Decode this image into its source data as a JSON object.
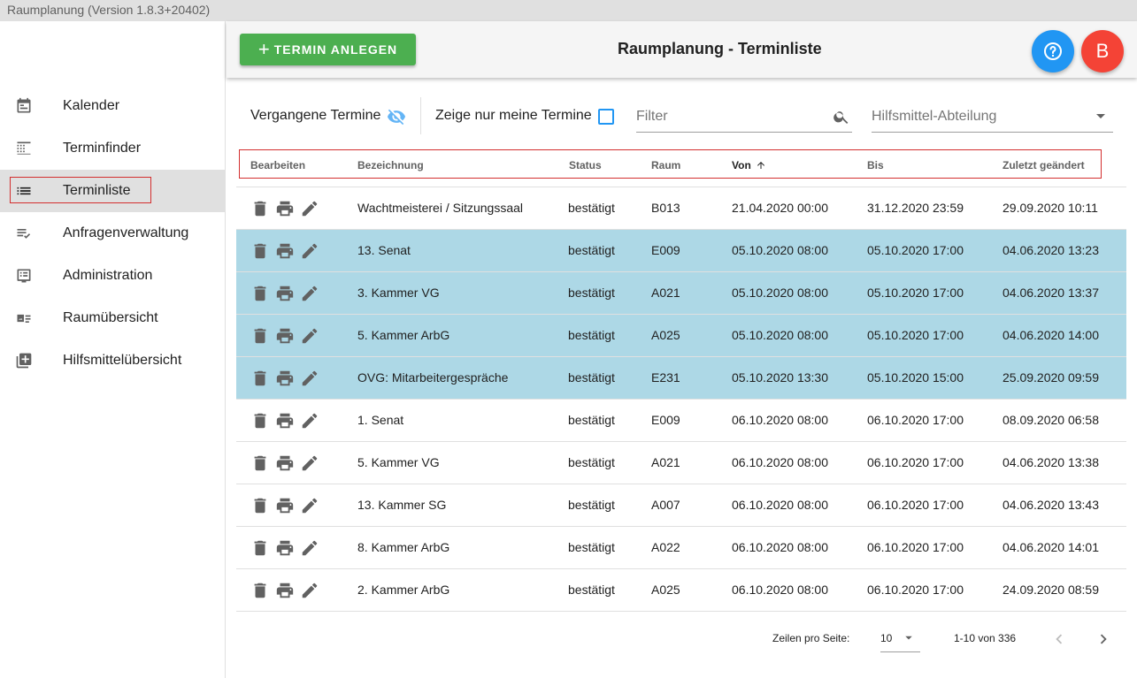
{
  "window": {
    "title": "Raumplanung (Version 1.8.3+20402)"
  },
  "sidebar": {
    "items": [
      {
        "label": "Kalender",
        "icon": "calendar-icon"
      },
      {
        "label": "Terminfinder",
        "icon": "grid-icon"
      },
      {
        "label": "Terminliste",
        "icon": "list-icon",
        "active": true
      },
      {
        "label": "Anfragenverwaltung",
        "icon": "playlist-check-icon"
      },
      {
        "label": "Administration",
        "icon": "admin-list-icon"
      },
      {
        "label": "Raumübersicht",
        "icon": "room-card-icon"
      },
      {
        "label": "Hilfsmittelübersicht",
        "icon": "library-add-icon"
      }
    ]
  },
  "header": {
    "add_button": "TERMIN ANLEGEN",
    "title": "Raumplanung - Terminliste",
    "user_initial": "B"
  },
  "filters": {
    "past_label": "Vergangene Termine",
    "mine_label": "Zeige nur meine Termine",
    "filter_placeholder": "Filter",
    "department_placeholder": "Hilfsmittel-Abteilung"
  },
  "table": {
    "columns": [
      "Bearbeiten",
      "Bezeichnung",
      "Status",
      "Raum",
      "Von",
      "Bis",
      "Zuletzt geändert"
    ],
    "sorted_column": "Von",
    "rows": [
      {
        "bezeichnung": "Wachtmeisterei / Sitzungssaal",
        "status": "bestätigt",
        "raum": "B013",
        "von": "21.04.2020 00:00",
        "bis": "31.12.2020 23:59",
        "geaendert": "29.09.2020 10:11",
        "highlight": false
      },
      {
        "bezeichnung": "13. Senat",
        "status": "bestätigt",
        "raum": "E009",
        "von": "05.10.2020 08:00",
        "bis": "05.10.2020 17:00",
        "geaendert": "04.06.2020 13:23",
        "highlight": true
      },
      {
        "bezeichnung": "3. Kammer VG",
        "status": "bestätigt",
        "raum": "A021",
        "von": "05.10.2020 08:00",
        "bis": "05.10.2020 17:00",
        "geaendert": "04.06.2020 13:37",
        "highlight": true
      },
      {
        "bezeichnung": "5. Kammer ArbG",
        "status": "bestätigt",
        "raum": "A025",
        "von": "05.10.2020 08:00",
        "bis": "05.10.2020 17:00",
        "geaendert": "04.06.2020 14:00",
        "highlight": true
      },
      {
        "bezeichnung": "OVG: Mitarbeitergespräche",
        "status": "bestätigt",
        "raum": "E231",
        "von": "05.10.2020 13:30",
        "bis": "05.10.2020 15:00",
        "geaendert": "25.09.2020 09:59",
        "highlight": true
      },
      {
        "bezeichnung": "1. Senat",
        "status": "bestätigt",
        "raum": "E009",
        "von": "06.10.2020 08:00",
        "bis": "06.10.2020 17:00",
        "geaendert": "08.09.2020 06:58",
        "highlight": false
      },
      {
        "bezeichnung": "5. Kammer VG",
        "status": "bestätigt",
        "raum": "A021",
        "von": "06.10.2020 08:00",
        "bis": "06.10.2020 17:00",
        "geaendert": "04.06.2020 13:38",
        "highlight": false
      },
      {
        "bezeichnung": "13. Kammer SG",
        "status": "bestätigt",
        "raum": "A007",
        "von": "06.10.2020 08:00",
        "bis": "06.10.2020 17:00",
        "geaendert": "04.06.2020 13:43",
        "highlight": false
      },
      {
        "bezeichnung": "8. Kammer ArbG",
        "status": "bestätigt",
        "raum": "A022",
        "von": "06.10.2020 08:00",
        "bis": "06.10.2020 17:00",
        "geaendert": "04.06.2020 14:01",
        "highlight": false
      },
      {
        "bezeichnung": "2. Kammer ArbG",
        "status": "bestätigt",
        "raum": "A025",
        "von": "06.10.2020 08:00",
        "bis": "06.10.2020 17:00",
        "geaendert": "24.09.2020 08:59",
        "highlight": false
      }
    ]
  },
  "pagination": {
    "rows_per_page_label": "Zeilen pro Seite:",
    "rows_per_page": "10",
    "range": "1-10 von 336"
  },
  "colors": {
    "accent_green": "#4caf50",
    "help_blue": "#2196f3",
    "user_red": "#f44336",
    "row_highlight": "#add8e6"
  }
}
